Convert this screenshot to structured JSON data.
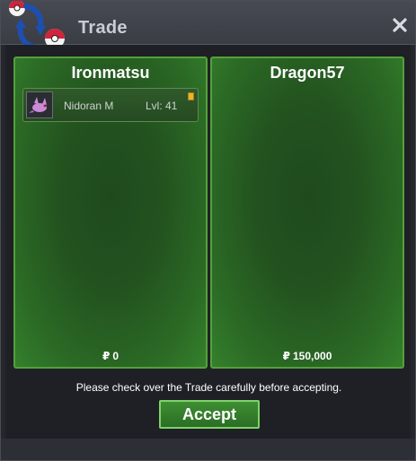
{
  "window": {
    "title": "Trade"
  },
  "trade": {
    "left": {
      "name": "Ironmatsu",
      "money_symbol": "₽",
      "money": "0",
      "items": [
        {
          "name": "Nidoran M",
          "level": "Lvl: 41",
          "icon": "nidoran-icon"
        }
      ]
    },
    "right": {
      "name": "Dragon57",
      "money_symbol": "₽",
      "money": "150,000",
      "items": []
    }
  },
  "notice": "Please check over the Trade carefully before accepting.",
  "buttons": {
    "accept": "Accept"
  },
  "colors": {
    "panel_border": "#55a03a",
    "panel_fill": "#2b6a25",
    "button_border": "#7fd26a"
  }
}
